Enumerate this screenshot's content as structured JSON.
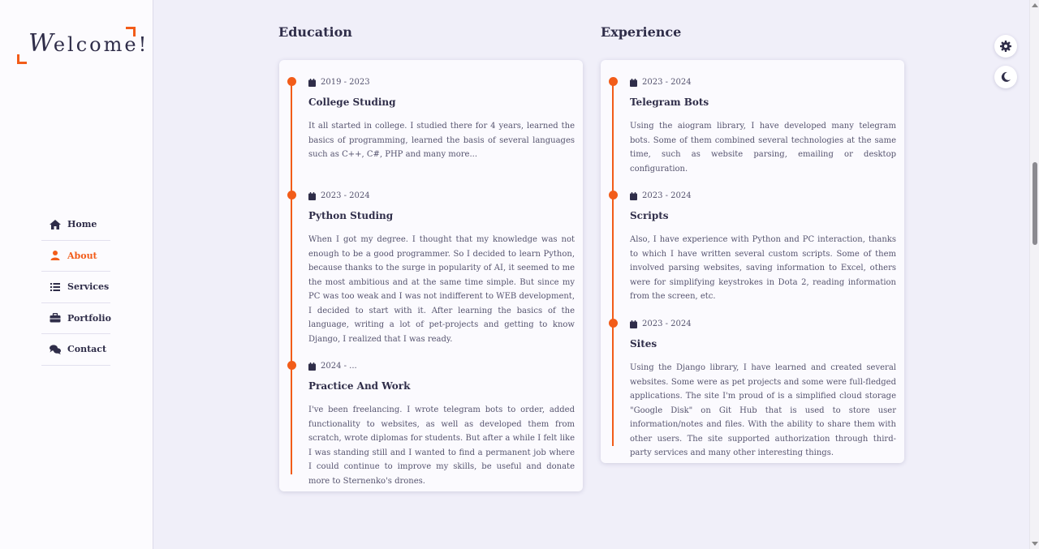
{
  "logo": {
    "first_letter": "W",
    "rest": "elcome!"
  },
  "nav": {
    "items": [
      {
        "label": "Home",
        "icon": "home-icon"
      },
      {
        "label": "About",
        "icon": "user-icon",
        "active": true
      },
      {
        "label": "Services",
        "icon": "list-icon"
      },
      {
        "label": "Portfolio",
        "icon": "briefcase-icon"
      },
      {
        "label": "Contact",
        "icon": "comments-icon"
      }
    ]
  },
  "education": {
    "title": "Education",
    "entries": [
      {
        "date": "2019 - 2023",
        "title": "College Studing",
        "text": "It all started in college. I studied there for 4 years, learned the basics of programming, learned the basis of several languages such as C++, C#, PHP and many more..."
      },
      {
        "date": "2023 - 2024",
        "title": "Python Studing",
        "text": "When I got my degree. I thought that my knowledge was not enough to be a good programmer. So I decided to learn Python, because thanks to the surge in popularity of AI, it seemed to me the most ambitious and at the same time simple. But since my PC was too weak and I was not indifferent to WEB development, I decided to start with it. After learning the basics of the language, writing a lot of pet-projects and getting to know Django, I realized that I was ready."
      },
      {
        "date": "2024 - ...",
        "title": "Practice And Work",
        "text": "I've been freelancing. I wrote telegram bots to order, added functionality to websites, as well as developed them from scratch, wrote diplomas for students. But after a while I felt like I was standing still and I wanted to find a permanent job where I could continue to improve my skills, be useful and donate more to Sternenko's drones."
      }
    ]
  },
  "experience": {
    "title": "Experience",
    "entries": [
      {
        "date": "2023 - 2024",
        "title": "Telegram Bots",
        "text": "Using the aiogram library, I have developed many telegram bots. Some of them combined several technologies at the same time, such as website parsing, emailing or desktop configuration."
      },
      {
        "date": "2023 - 2024",
        "title": "Scripts",
        "text": "Also, I have experience with Python and PC interaction, thanks to which I have written several custom scripts. Some of them involved parsing websites, saving information to Excel, others were for simplifying keystrokes in Dota 2, reading information from the screen, etc."
      },
      {
        "date": "2023 - 2024",
        "title": "Sites",
        "text": "Using the Django library, I have learned and created several websites. Some were as pet projects and some were full-fledged applications. The site I'm proud of is a simplified cloud storage \"Google Disk\" on Git Hub that is used to store user information/notes and files. With the ability to share them with other users. The site supported authorization through third-party services and many other interesting things."
      }
    ]
  },
  "tools": {
    "settings_icon": "gear-icon",
    "theme_icon": "moon-icon"
  },
  "colors": {
    "accent": "#f25c19",
    "text": "#2f2d49",
    "background": "#f0eff9"
  }
}
